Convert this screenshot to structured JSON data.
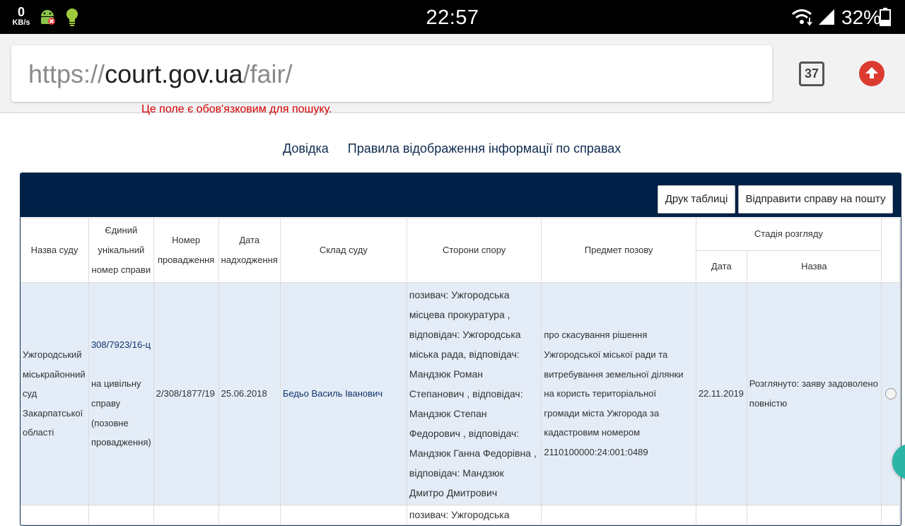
{
  "status_bar": {
    "net_speed": "0",
    "net_unit": "KB/s",
    "time": "22:57",
    "battery": "32%"
  },
  "browser": {
    "url_scheme": "https://",
    "url_host": "court.gov.ua",
    "url_path": "/fair/",
    "tab_count": "37"
  },
  "page": {
    "hint": "Це поле є обов'язковим для пошуку.",
    "links": [
      "Довідка",
      "Правила відображення інформації по справах"
    ],
    "buttons": {
      "print": "Друк таблиці",
      "mail": "Відправити справу на пошту"
    },
    "table": {
      "headers": {
        "court": "Назва суду",
        "case_number": "Єдиний унікальний номер справи",
        "proceeding": "Номер провадження",
        "received": "Дата надходження",
        "judges": "Склад суду",
        "parties": "Сторони спору",
        "subject": "Предмет позову",
        "stage": "Стадія розгляду",
        "stage_date": "Дата",
        "stage_name": "Назва"
      },
      "rows": [
        {
          "court": "Ужгородський міськрайонний суд Закарпатської області",
          "case_number": "308/7923/16-ц",
          "case_type": "на цивільну справу (позовне провадження)",
          "proceeding": "2/308/1877/19",
          "received": "25.06.2018",
          "judges": "Бедьо Василь Іванович",
          "parties": "позивач: Ужгородська місцева прокуратура , відповідач: Ужгородська міська рада, відповідач: Мандзюк Роман Степанович , відповідач: Мандзюк Степан Федорович , відповідач: Мандзюк Ганна Федорівна , відповідач: Мандзюк Дмитро Дмитрович",
          "subject": "про скасування рішення Ужгородської міської ради та витребування земельної ділянки на користь територіальної громади міста Ужгорода за кадастровим номером 2110100000:24:001:0489",
          "stage_date": "22.11.2019",
          "stage_name": "Розглянуто: заяву задоволено повністю"
        }
      ],
      "next_row_parties": "позивач: Ужгородська"
    }
  },
  "colors": {
    "panel_header": "#002147",
    "row_highlight": "#e4ecf7",
    "hint_red": "#d50000",
    "link_navy": "#0f2b4f",
    "upload_red": "#db3b31"
  }
}
